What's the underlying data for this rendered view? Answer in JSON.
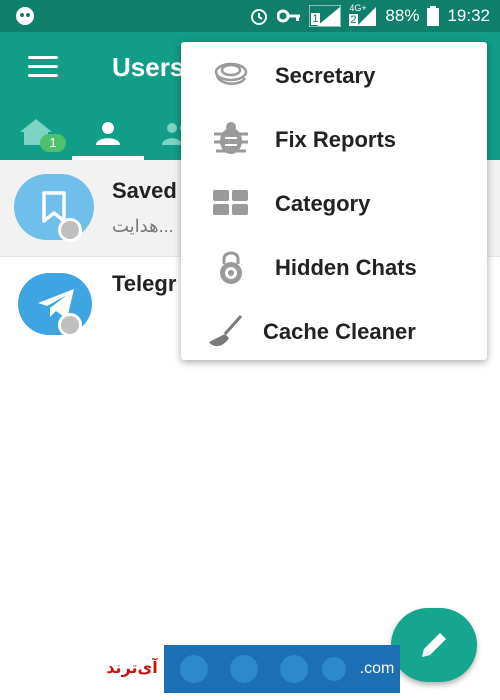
{
  "status_bar": {
    "battery": "88%",
    "time": "19:32",
    "sim1": "1",
    "sim2": "2",
    "network": "4G+"
  },
  "app_bar": {
    "title": "Users"
  },
  "tabs": [
    {
      "icon": "home-icon",
      "badge": "1"
    },
    {
      "icon": "person-icon",
      "active": true
    },
    {
      "icon": "group-icon"
    }
  ],
  "chats": [
    {
      "title": "Saved",
      "subtitle": "هدایت...",
      "avatar_color": "#6fbfea",
      "icon": "bookmark-icon"
    },
    {
      "title": "Telegr",
      "subtitle": "",
      "avatar_color": "#3ea4e2",
      "icon": "telegram-plane-icon"
    }
  ],
  "menu": {
    "items": [
      {
        "label": "Secretary",
        "icon": "secretary-icon"
      },
      {
        "label": "Fix Reports",
        "icon": "bug-icon"
      },
      {
        "label": "Category",
        "icon": "category-icon"
      },
      {
        "label": "Hidden Chats",
        "icon": "lock-icon"
      },
      {
        "label": "Cache Cleaner",
        "icon": "broom-icon"
      }
    ]
  },
  "fab": {
    "icon": "pencil-icon"
  },
  "watermark": {
    "left_text": "آی‌ترند",
    "right_text": ".com"
  },
  "colors": {
    "status_bar": "#0f7f6b",
    "app_bar": "#119d88",
    "fab": "#16a58f",
    "badge": "#4fc06c"
  }
}
